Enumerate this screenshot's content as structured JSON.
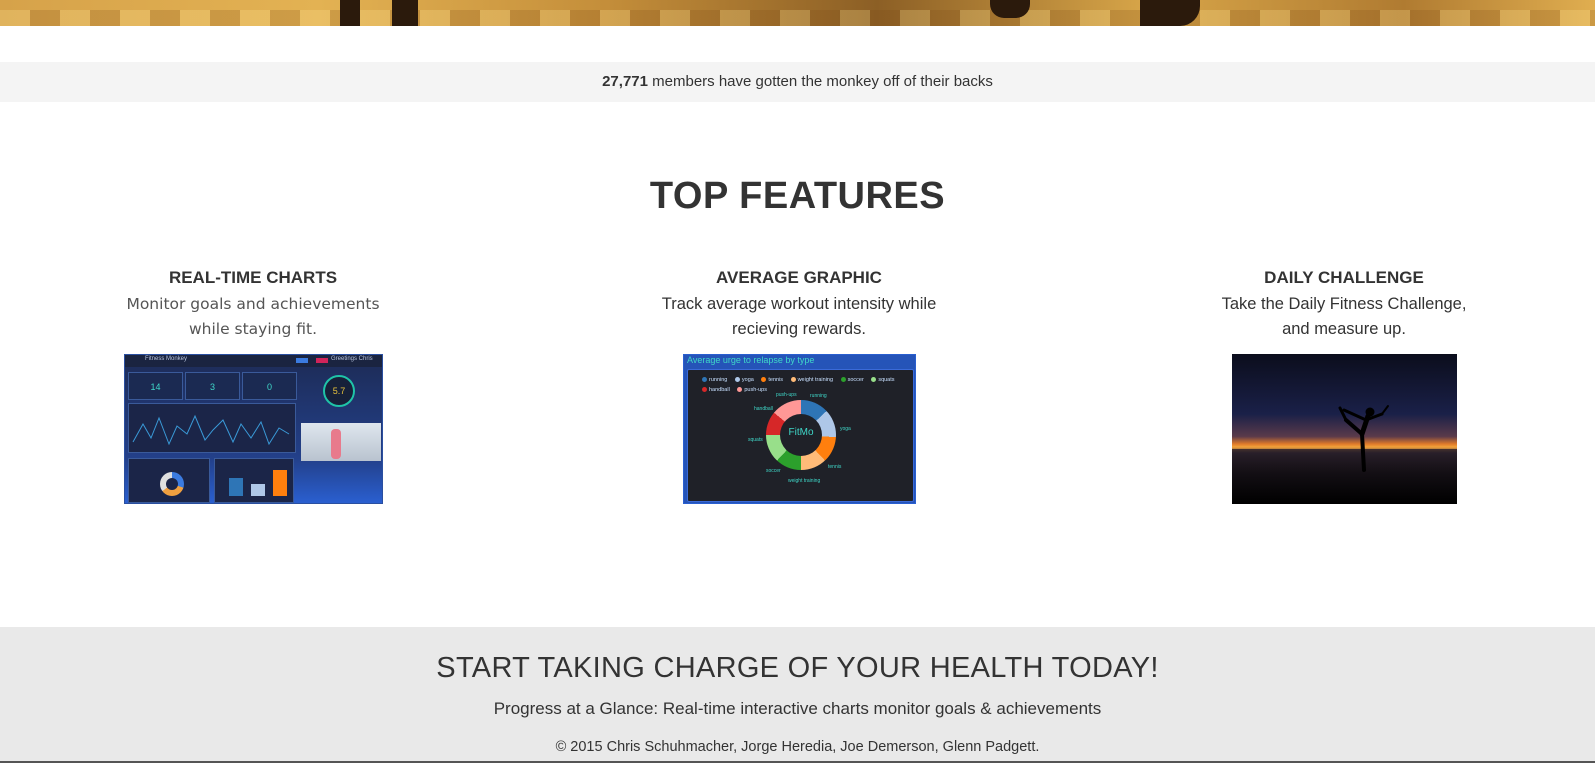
{
  "members": {
    "count": "27,771",
    "text": " members have gotten the monkey off of their backs"
  },
  "features": {
    "title": "TOP FEATURES",
    "items": [
      {
        "heading": "REAL-TIME CHARTS",
        "line1": "Monitor goals and achievements",
        "line2": "while staying fit."
      },
      {
        "heading": "AVERAGE GRAPHIC",
        "line1": "Track average workout intensity while",
        "line2": "recieving rewards."
      },
      {
        "heading": "DAILY CHALLENGE",
        "line1": "Take the Daily Fitness Challenge,",
        "line2": "and measure up."
      }
    ]
  },
  "dashboard_thumb": {
    "app_name": "Fitness Monkey",
    "greeting": "Greetings Chris",
    "stats": [
      "14",
      "3",
      "0"
    ],
    "gauge": "5.7"
  },
  "average_thumb": {
    "title": "Average urge to relapse by type",
    "center": "FitMo",
    "legend": [
      "running",
      "yoga",
      "tennis",
      "weight training",
      "soccer",
      "squats",
      "handball",
      "push-ups"
    ]
  },
  "cta": {
    "heading": "START TAKING CHARGE OF YOUR HEALTH TODAY!",
    "subtitle": "Progress at a Glance: Real-time interactive charts monitor goals & achievements",
    "copyright": "© 2015 Chris Schuhmacher, Jorge Heredia, Joe Demerson, Glenn Padgett."
  }
}
